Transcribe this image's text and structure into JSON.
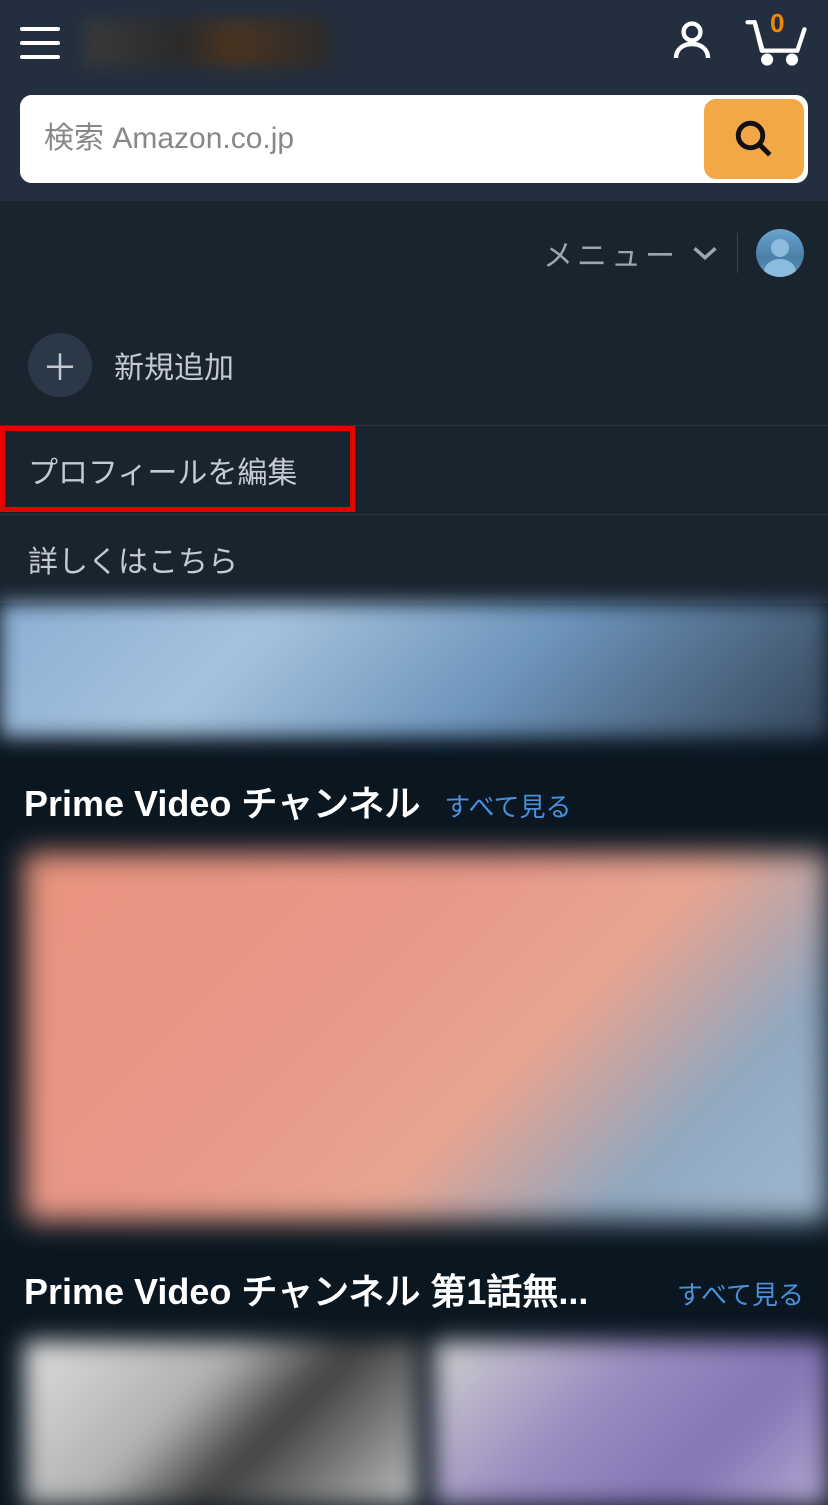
{
  "header": {
    "cart_count": "0",
    "search_placeholder": "検索 Amazon.co.jp"
  },
  "subnav": {
    "menu_label": "メニュー"
  },
  "dropdown": {
    "add_new": "新規追加",
    "edit_profile": "プロフィールを編集",
    "learn_more": "詳しくはこちら"
  },
  "sections": [
    {
      "title": "Prime Video チャンネル",
      "see_all": "すべて見る"
    },
    {
      "title": "Prime Video チャンネル 第1話無...",
      "see_all": "すべて見る"
    }
  ]
}
